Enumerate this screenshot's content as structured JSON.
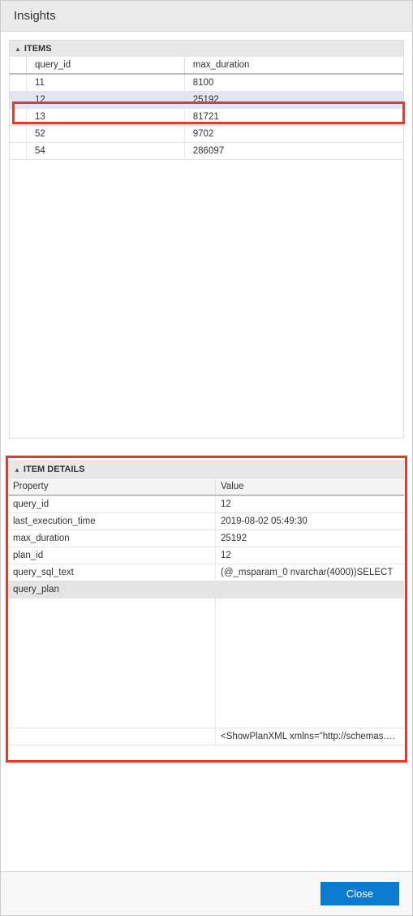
{
  "header": {
    "title": "Insights"
  },
  "items_section": {
    "title": "ITEMS",
    "columns": {
      "col1": "query_id",
      "col2": "max_duration"
    },
    "rows": [
      {
        "query_id": "11",
        "max_duration": "8100",
        "selected": false
      },
      {
        "query_id": "12",
        "max_duration": "25192",
        "selected": true
      },
      {
        "query_id": "13",
        "max_duration": "81721",
        "selected": false
      },
      {
        "query_id": "52",
        "max_duration": "9702",
        "selected": false
      },
      {
        "query_id": "54",
        "max_duration": "286097",
        "selected": false
      }
    ]
  },
  "details_section": {
    "title": "ITEM DETAILS",
    "columns": {
      "col1": "Property",
      "col2": "Value"
    },
    "rows": [
      {
        "property": "query_id",
        "value": "12",
        "selected": false
      },
      {
        "property": "last_execution_time",
        "value": "2019-08-02 05:49:30",
        "selected": false
      },
      {
        "property": "max_duration",
        "value": "25192",
        "selected": false
      },
      {
        "property": "plan_id",
        "value": "12",
        "selected": false
      },
      {
        "property": "query_sql_text",
        "value": "(@_msparam_0 nvarchar(4000))SELECT",
        "selected": false
      },
      {
        "property": "query_plan",
        "value": "",
        "selected": true
      }
    ],
    "extra_value": "<ShowPlanXML xmlns=\"http://schemas.microsof..."
  },
  "footer": {
    "close": "Close"
  }
}
